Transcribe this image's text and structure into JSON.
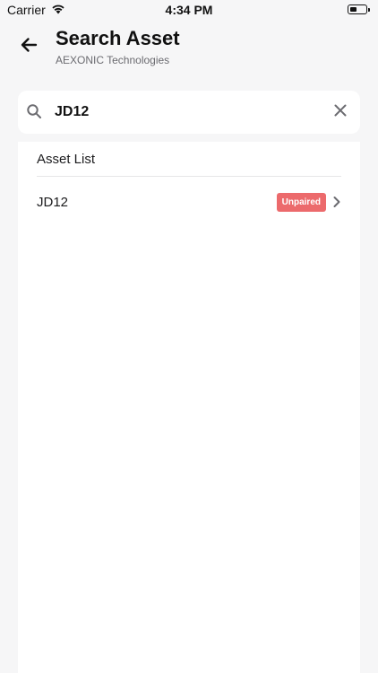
{
  "status_bar": {
    "carrier": "Carrier",
    "time": "4:34 PM",
    "wifi_icon": "wifi-icon",
    "battery_icon": "battery-icon"
  },
  "header": {
    "back_icon": "arrow-left-icon",
    "title": "Search Asset",
    "subtitle": "AEXONIC Technologies"
  },
  "search": {
    "icon": "search-icon",
    "value": "JD12",
    "clear_icon": "close-icon"
  },
  "list": {
    "header": "Asset List",
    "items": [
      {
        "name": "JD12",
        "status": "Unpaired",
        "chevron_icon": "chevron-right-icon"
      }
    ]
  },
  "colors": {
    "background": "#f6f6f7",
    "card": "#ffffff",
    "badge_unpaired": "#ec6a6c"
  }
}
